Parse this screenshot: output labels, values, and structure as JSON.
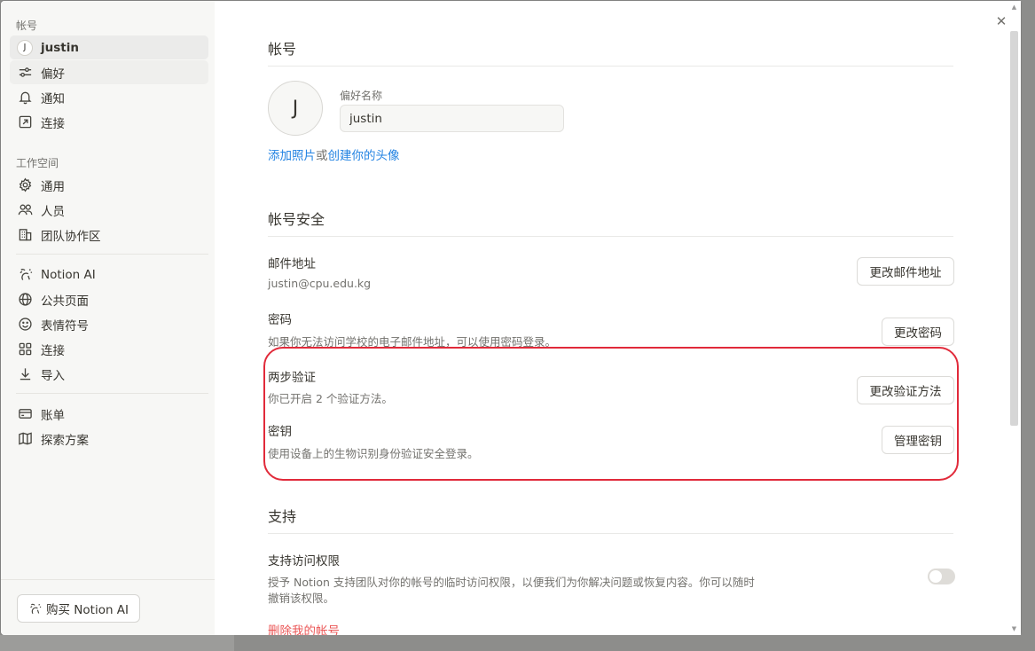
{
  "sidebar": {
    "account_section": "帐号",
    "account_items": [
      {
        "label": "justin",
        "icon": "avatar",
        "avatar_letter": "J"
      },
      {
        "label": "偏好",
        "icon": "sliders-icon"
      },
      {
        "label": "通知",
        "icon": "bell-icon"
      },
      {
        "label": "连接",
        "icon": "arrow-up-right-box-icon"
      }
    ],
    "workspace_section": "工作空间",
    "workspace_items": [
      {
        "label": "通用",
        "icon": "gear-icon"
      },
      {
        "label": "人员",
        "icon": "people-icon"
      },
      {
        "label": "团队协作区",
        "icon": "building-icon"
      }
    ],
    "feature_items": [
      {
        "label": "Notion AI",
        "icon": "ai-face-icon"
      },
      {
        "label": "公共页面",
        "icon": "globe-icon"
      },
      {
        "label": "表情符号",
        "icon": "smiley-icon"
      },
      {
        "label": "连接",
        "icon": "grid-icon"
      },
      {
        "label": "导入",
        "icon": "download-icon"
      }
    ],
    "billing_items": [
      {
        "label": "账单",
        "icon": "card-icon"
      },
      {
        "label": "探索方案",
        "icon": "map-icon"
      }
    ],
    "buy_button": "购买 Notion AI"
  },
  "account": {
    "heading": "帐号",
    "avatar_letter": "J",
    "preferred_name_label": "偏好名称",
    "preferred_name_value": "justin",
    "add_photo": "添加照片",
    "or_text": "或",
    "create_avatar": "创建你的头像"
  },
  "security": {
    "heading": "帐号安全",
    "email_title": "邮件地址",
    "email_value": "justin@cpu.edu.kg",
    "email_button": "更改邮件地址",
    "password_title": "密码",
    "password_desc": "如果你无法访问学校的电子邮件地址，可以使用密码登录。",
    "password_button": "更改密码",
    "twofa_title": "两步验证",
    "twofa_desc": "你已开启 2 个验证方法。",
    "twofa_button": "更改验证方法",
    "passkey_title": "密钥",
    "passkey_desc": "使用设备上的生物识别身份验证安全登录。",
    "passkey_button": "管理密钥"
  },
  "support": {
    "heading": "支持",
    "access_title": "支持访问权限",
    "access_desc_line1": "授予 Notion 支持团队对你的帐号的临时访问权限，以便我们为你解决问题或恢复内容。你可以随时",
    "access_desc_line2": "撤销该权限。",
    "toggle_on": false,
    "delete_account": "删除我的帐号"
  },
  "colors": {
    "link": "#2383e2",
    "danger": "#eb5757",
    "highlight": "#e12a3a"
  }
}
